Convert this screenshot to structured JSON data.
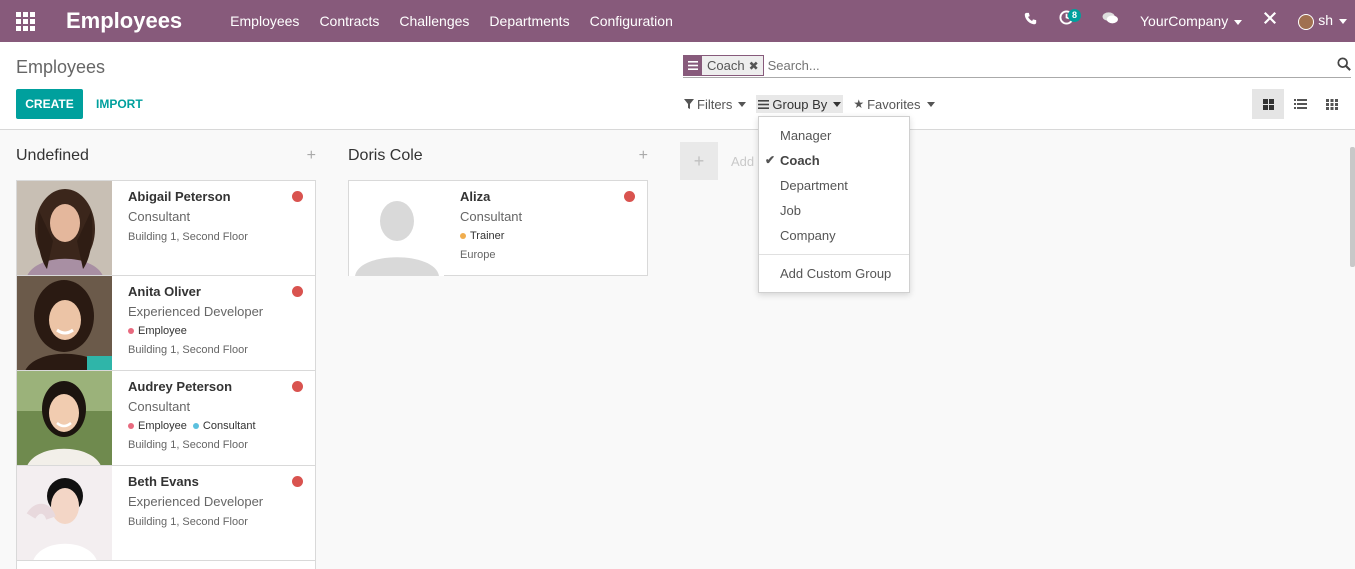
{
  "navbar": {
    "app_title": "Employees",
    "menu": [
      "Employees",
      "Contracts",
      "Challenges",
      "Departments",
      "Configuration"
    ],
    "activity_count": "8",
    "company": "YourCompany",
    "user": "sh",
    "bg_color": "#875a7b"
  },
  "control": {
    "breadcrumb": "Employees",
    "create_label": "CREATE",
    "import_label": "IMPORT",
    "search": {
      "facet_value": "Coach",
      "placeholder": "Search..."
    },
    "filters_label": "Filters",
    "groupby_label": "Group By",
    "favorites_label": "Favorites"
  },
  "groupby_menu": {
    "items": [
      {
        "label": "Manager",
        "selected": false
      },
      {
        "label": "Coach",
        "selected": true
      },
      {
        "label": "Department",
        "selected": false
      },
      {
        "label": "Job",
        "selected": false
      },
      {
        "label": "Company",
        "selected": false
      }
    ],
    "custom_label": "Add Custom Group"
  },
  "kanban": {
    "columns": [
      {
        "title": "Undefined",
        "cards": [
          {
            "name": "Abigail Peterson",
            "job": "Consultant",
            "tags": [],
            "location": "Building 1, Second Floor"
          },
          {
            "name": "Anita Oliver",
            "job": "Experienced Developer",
            "tags": [
              {
                "label": "Employee",
                "color": "#e86a7f"
              }
            ],
            "location": "Building 1, Second Floor"
          },
          {
            "name": "Audrey Peterson",
            "job": "Consultant",
            "tags": [
              {
                "label": "Employee",
                "color": "#e86a7f"
              },
              {
                "label": "Consultant",
                "color": "#5bc0de"
              }
            ],
            "location": "Building 1, Second Floor"
          },
          {
            "name": "Beth Evans",
            "job": "Experienced Developer",
            "tags": [],
            "location": "Building 1, Second Floor"
          }
        ]
      },
      {
        "title": "Doris Cole",
        "cards": [
          {
            "name": "Aliza",
            "job": "Consultant",
            "tags": [
              {
                "label": "Trainer",
                "color": "#f0ad4e"
              }
            ],
            "location": "Europe"
          }
        ]
      }
    ],
    "add_column_label": "Add"
  }
}
